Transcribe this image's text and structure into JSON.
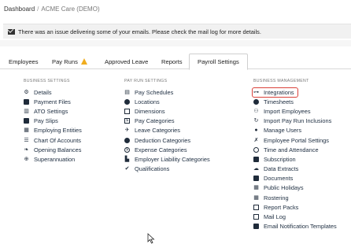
{
  "breadcrumb": {
    "root": "Dashboard",
    "separator": "/",
    "current": "ACME Care (DEMO)"
  },
  "alert": {
    "icon": "envelope-icon",
    "text": "There was an issue delivering some of your emails. Please check the mail log for more details."
  },
  "tabs": [
    {
      "label": "Employees"
    },
    {
      "label": "Pay Runs",
      "badge_icon": "warning-icon"
    },
    {
      "label": "Approved Leave"
    },
    {
      "label": "Reports"
    },
    {
      "label": "Payroll Settings",
      "active": true
    }
  ],
  "columns": {
    "business_settings": {
      "heading": "BUSINESS SETTINGS",
      "items": [
        {
          "label": "Details",
          "icon": "gear-icon"
        },
        {
          "label": "Payment Files",
          "icon": "file-icon"
        },
        {
          "label": "ATO Settings",
          "icon": "building-icon"
        },
        {
          "label": "Pay Slips",
          "icon": "document-icon"
        },
        {
          "label": "Employing Entities",
          "icon": "entities-icon"
        },
        {
          "label": "Chart Of Accounts",
          "icon": "list-icon"
        },
        {
          "label": "Opening Balances",
          "icon": "leaf-icon"
        },
        {
          "label": "Superannuation",
          "icon": "lifebuoy-icon"
        }
      ]
    },
    "pay_run_settings": {
      "heading": "PAY RUN SETTINGS",
      "items": [
        {
          "label": "Pay Schedules",
          "icon": "calendar-icon"
        },
        {
          "label": "Locations",
          "icon": "globe-icon"
        },
        {
          "label": "Dimensions",
          "icon": "table-icon"
        },
        {
          "label": "Pay Categories",
          "icon": "dollar-icon"
        },
        {
          "label": "Leave Categories",
          "icon": "plane-icon"
        },
        {
          "label": "Deduction Categories",
          "icon": "minus-circle-icon"
        },
        {
          "label": "Expense Categories",
          "icon": "dollar-circle-icon"
        },
        {
          "label": "Employer Liability Categories",
          "icon": "bar-chart-icon"
        },
        {
          "label": "Qualifications",
          "icon": "check-icon"
        }
      ]
    },
    "business_management": {
      "heading": "BUSINESS MANAGEMENT",
      "items": [
        {
          "label": "Integrations",
          "icon": "plug-icon",
          "highlighted": true
        },
        {
          "label": "Timesheets",
          "icon": "clock-icon"
        },
        {
          "label": "Import Employees",
          "icon": "users-icon"
        },
        {
          "label": "Import Pay Run Inclusions",
          "icon": "refresh-icon"
        },
        {
          "label": "Manage Users",
          "icon": "user-group-icon"
        },
        {
          "label": "Employee Portal Settings",
          "icon": "wrench-icon"
        },
        {
          "label": "Time and Attendance",
          "icon": "clock-circle-icon"
        },
        {
          "label": "Subscription",
          "icon": "credit-card-icon"
        },
        {
          "label": "Data Extracts",
          "icon": "cloud-download-icon"
        },
        {
          "label": "Documents",
          "icon": "folder-icon"
        },
        {
          "label": "Public Holidays",
          "icon": "calendar-grid-icon"
        },
        {
          "label": "Rostering",
          "icon": "table-icon"
        },
        {
          "label": "Report Packs",
          "icon": "folder-open-icon"
        },
        {
          "label": "Mail Log",
          "icon": "envelope-outline-icon"
        },
        {
          "label": "Email Notification Templates",
          "icon": "envelope-icon"
        }
      ]
    }
  }
}
